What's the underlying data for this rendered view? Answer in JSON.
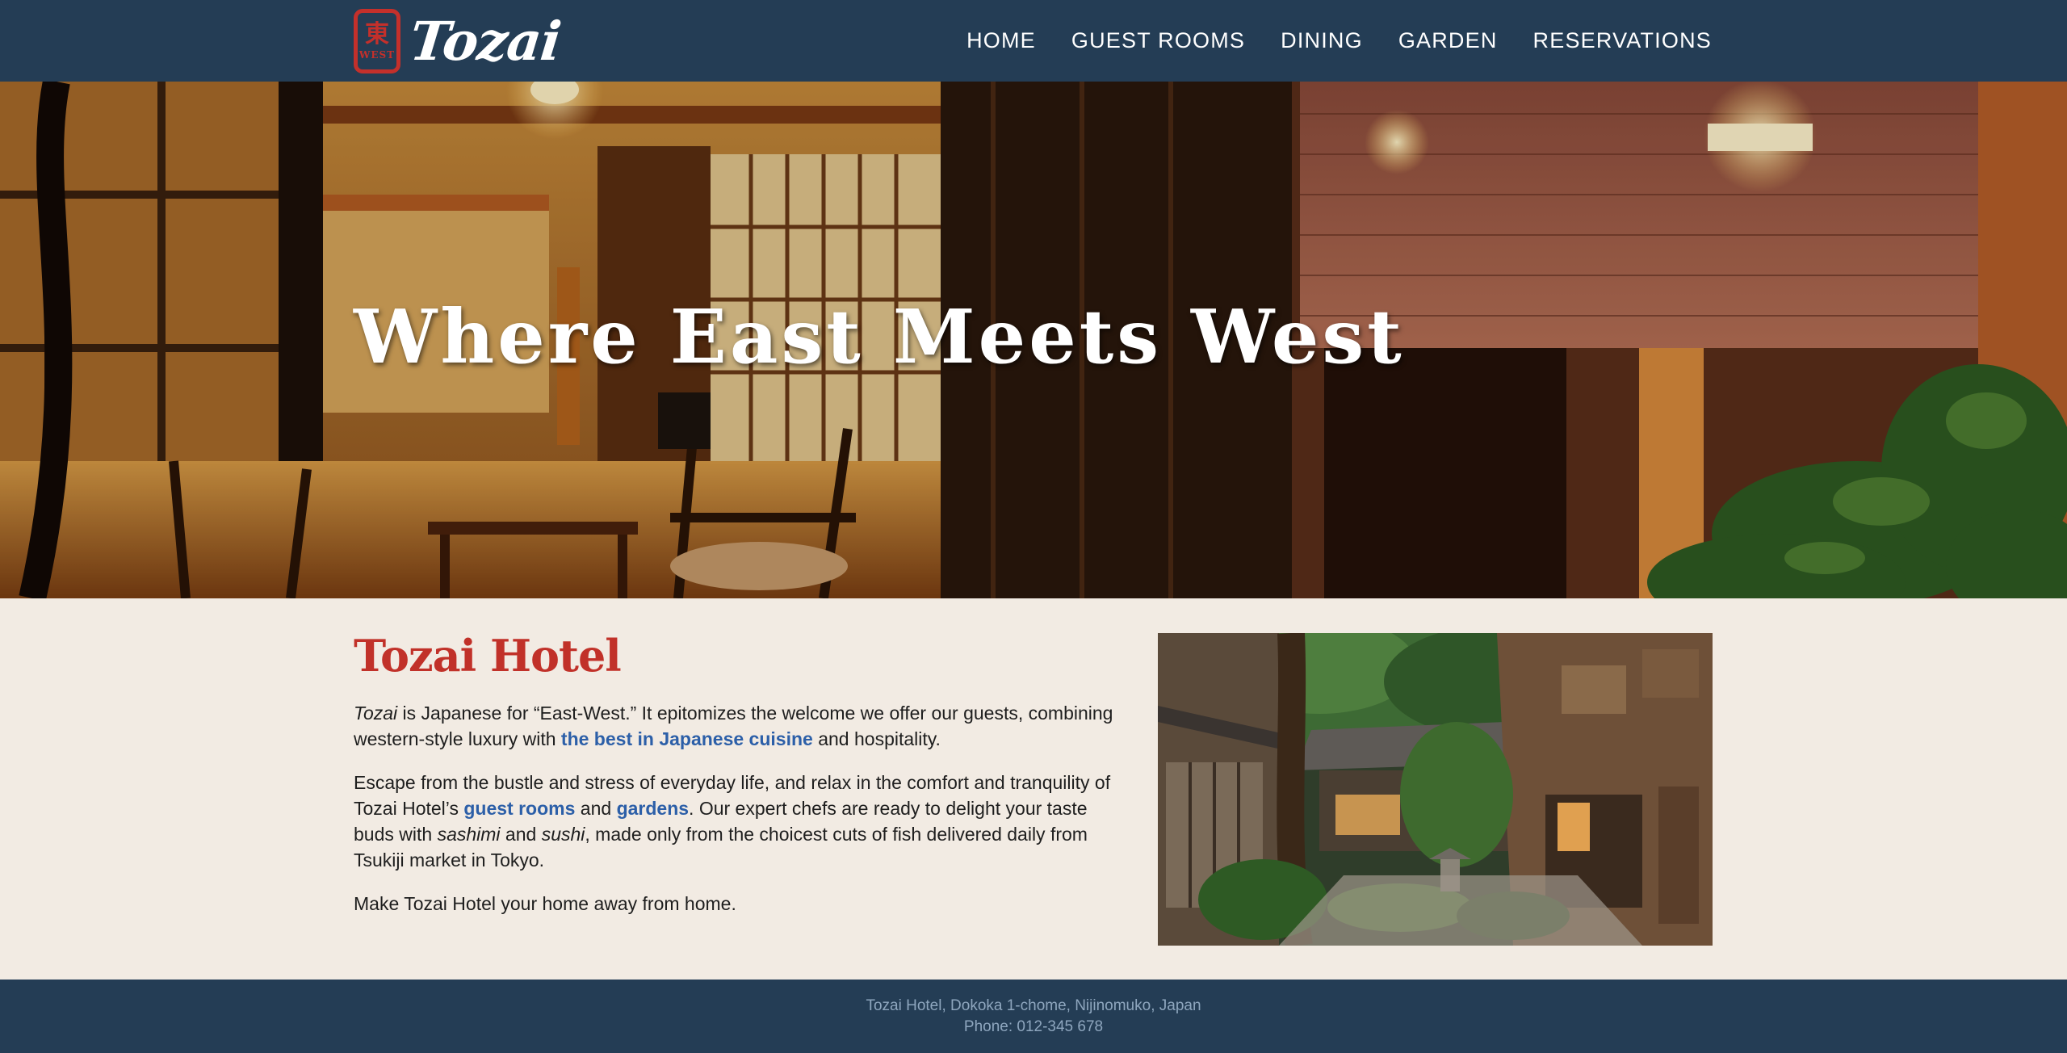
{
  "header": {
    "logo_text": "Tozai",
    "seal_text_top": "東",
    "seal_text_bottom": "WEST",
    "nav": [
      "HOME",
      "GUEST ROOMS",
      "DINING",
      "GARDEN",
      "RESERVATIONS"
    ]
  },
  "hero": {
    "title": "Where East Meets West"
  },
  "main": {
    "heading": "Tozai Hotel",
    "p1": {
      "em": "Tozai",
      "t1": " is Japanese for “East-West.” It epitomizes the welcome we offer our guests, combining western-style luxury with ",
      "link": "the best in Japanese cuisine",
      "t2": " and hospitality."
    },
    "p2": {
      "t1": "Escape from the bustle and stress of everyday life, and relax in the comfort and tranquility of Tozai Hotel’s ",
      "link1": "guest rooms",
      "t2": " and ",
      "link2": "gardens",
      "t3": ". Our expert chefs are ready to delight your taste buds with ",
      "em1": "sashimi",
      "t4": " and ",
      "em2": "sushi",
      "t5": ", made only from the choicest cuts of fish delivered daily from Tsukiji market in Tokyo."
    },
    "p3": "Make Tozai Hotel your home away from home."
  },
  "footer": {
    "address": "Tozai Hotel, Dokoka 1-chome, Nijinomuko, Japan",
    "phone": "Phone: 012-345 678"
  },
  "colors": {
    "header_bg": "#243d55",
    "accent_red": "#c13129",
    "link_blue": "#2c5fa8",
    "page_bg": "#f2ebe3"
  }
}
